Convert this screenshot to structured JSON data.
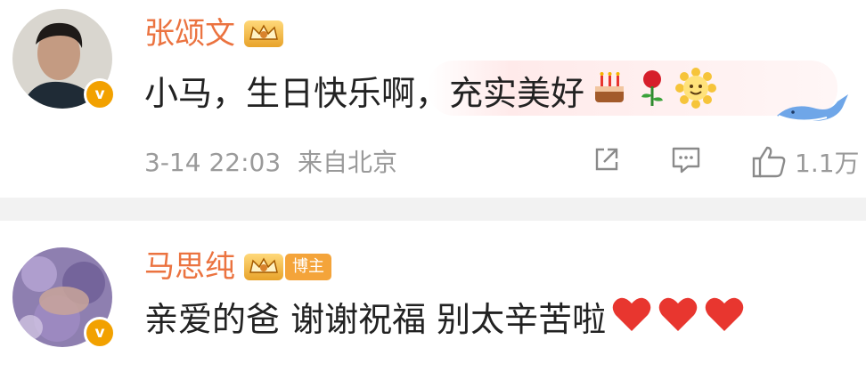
{
  "comments": [
    {
      "username": "张颂文",
      "badge": "",
      "text": "小马，生日快乐啊，充实美好",
      "emojis": [
        "cake-emoji",
        "rose-emoji",
        "sun-smile-emoji"
      ],
      "timestamp": "3-14 22:03",
      "source": "来自北京",
      "likes": "1.1万",
      "verified_mark": "v"
    },
    {
      "username": "马思纯",
      "badge": "博主",
      "text": "亲爱的爸 谢谢祝福 别太辛苦啦",
      "emojis": [
        "heart-emoji",
        "heart-emoji",
        "heart-emoji"
      ],
      "verified_mark": "v"
    }
  ],
  "colors": {
    "username": "#eb7340",
    "verified": "#f2a100",
    "meta": "#9a9a9a",
    "heart": "#e8362f",
    "divider": "#f2f2f2"
  }
}
